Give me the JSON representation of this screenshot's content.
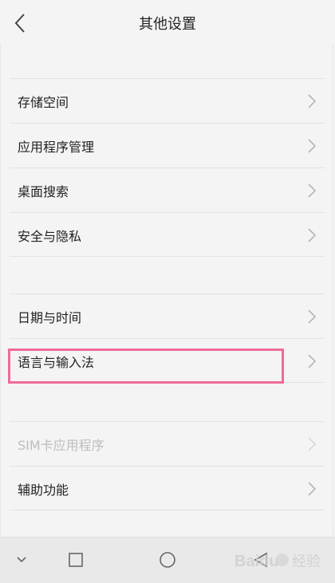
{
  "header": {
    "title": "其他设置"
  },
  "rows": [
    {
      "label": "存储空间",
      "enabled": true
    },
    {
      "label": "应用程序管理",
      "enabled": true
    },
    {
      "label": "桌面搜索",
      "enabled": true
    },
    {
      "label": "安全与隐私",
      "enabled": true
    },
    {
      "label": "日期与时间",
      "enabled": true
    },
    {
      "label": "语言与输入法",
      "enabled": true
    },
    {
      "label": "SIM卡应用程序",
      "enabled": false
    },
    {
      "label": "辅助功能",
      "enabled": true
    }
  ],
  "colors": {
    "background": "#f4f4f4",
    "highlight": "#ef6b9c",
    "disabled_text": "#bdbdbd",
    "chevron": "#b5b5b5"
  },
  "icons": {
    "back": "chevron-left-icon",
    "row_chevron": "chevron-right-icon",
    "nav_collapse": "chevron-down-icon",
    "nav_recent": "square-icon",
    "nav_home": "circle-icon",
    "nav_back": "triangle-left-icon"
  },
  "watermark": {
    "brand": "Baidu",
    "text": "经验"
  }
}
